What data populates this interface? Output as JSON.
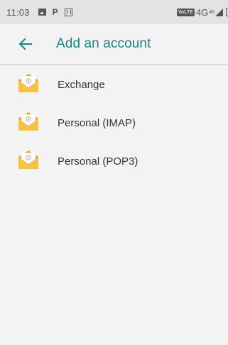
{
  "status_bar": {
    "time": "11:03",
    "network_badge": "VoLTE",
    "network_type": "4G",
    "network_sup": "46"
  },
  "toolbar": {
    "title": "Add an account"
  },
  "accounts": [
    {
      "label": "Exchange"
    },
    {
      "label": "Personal (IMAP)"
    },
    {
      "label": "Personal (POP3)"
    }
  ],
  "colors": {
    "accent": "#128a7f",
    "envelope": "#f6c340",
    "envelope_shadow": "#e5a820",
    "background": "#f3f3f3",
    "status_bar": "#e3e3e3"
  }
}
